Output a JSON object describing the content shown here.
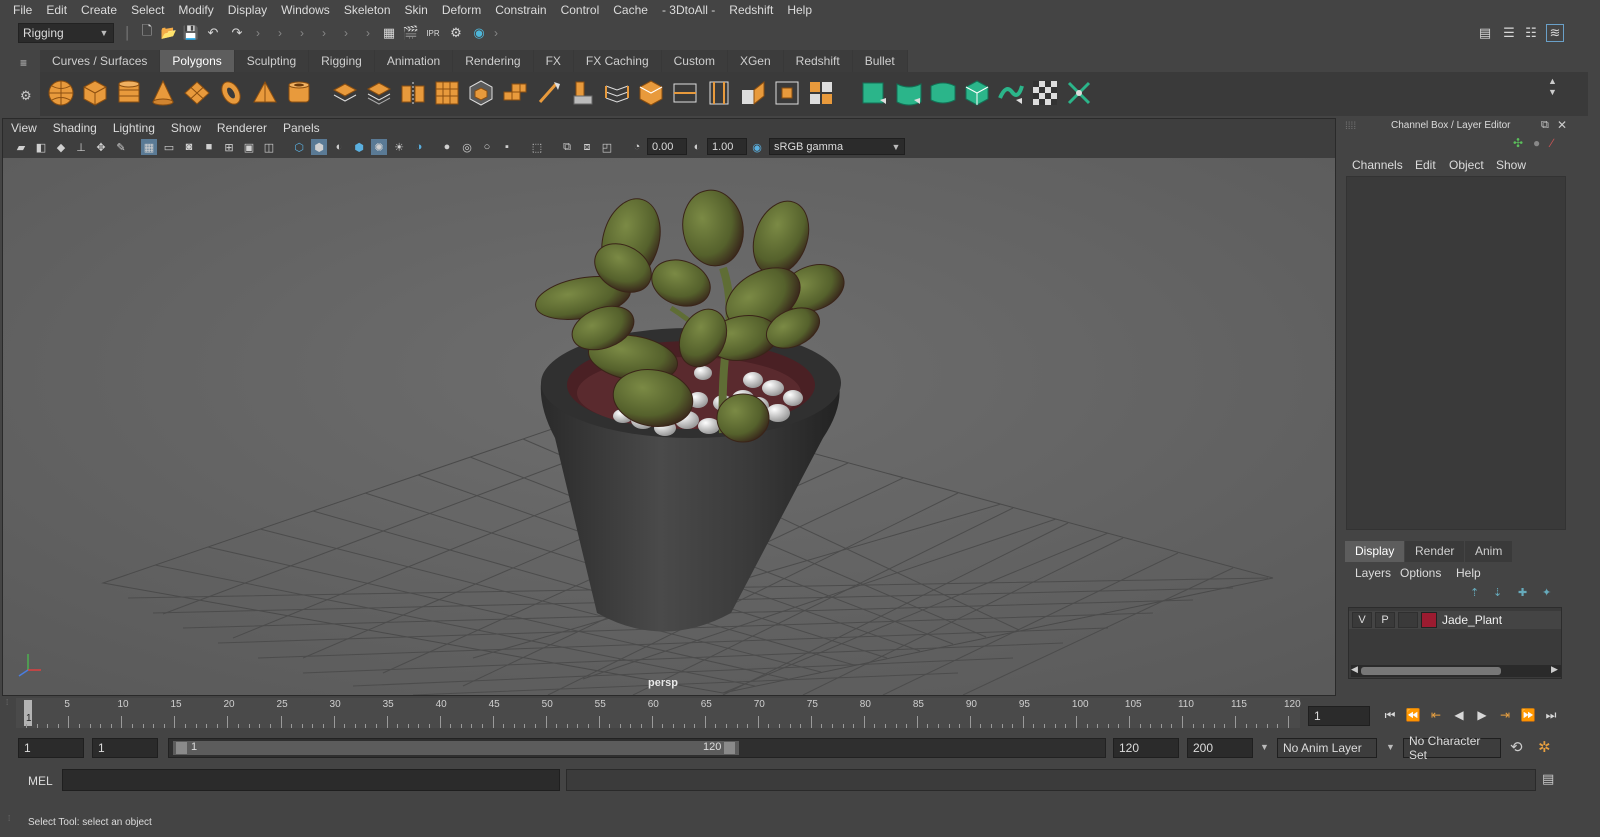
{
  "menubar": {
    "items": [
      "File",
      "Edit",
      "Create",
      "Select",
      "Modify",
      "Display",
      "Windows",
      "Skeleton",
      "Skin",
      "Deform",
      "Constrain",
      "Control",
      "Cache",
      "- 3DtoAll -",
      "Redshift",
      "Help"
    ]
  },
  "statusline": {
    "menuset": "Rigging"
  },
  "shelf": {
    "tabs": [
      "Curves / Surfaces",
      "Polygons",
      "Sculpting",
      "Rigging",
      "Animation",
      "Rendering",
      "FX",
      "FX Caching",
      "Custom",
      "XGen",
      "Redshift",
      "Bullet"
    ],
    "active_tab": "Polygons"
  },
  "panel": {
    "menus": [
      "View",
      "Shading",
      "Lighting",
      "Show",
      "Renderer",
      "Panels"
    ],
    "exposure": "0.00",
    "gamma": "1.00",
    "colorspace": "sRGB gamma",
    "camera_label": "persp"
  },
  "right_panel": {
    "title": "Channel Box / Layer Editor",
    "channel_menus": [
      "Channels",
      "Edit",
      "Object",
      "Show"
    ],
    "layer_tabs": [
      "Display",
      "Render",
      "Anim"
    ],
    "active_layer_tab": "Display",
    "layer_menus": [
      "Layers",
      "Options",
      "Help"
    ],
    "layers": [
      {
        "visible": "V",
        "playback": "P",
        "color": "#9b1b30",
        "name": "Jade_Plant"
      }
    ]
  },
  "timeline": {
    "ticks": [
      "5",
      "10",
      "15",
      "20",
      "25",
      "30",
      "35",
      "40",
      "45",
      "50",
      "55",
      "60",
      "65",
      "70",
      "75",
      "80",
      "85",
      "90",
      "95",
      "100",
      "105",
      "110",
      "115",
      "120"
    ],
    "current_marker": "1",
    "current_frame": "1"
  },
  "range": {
    "start": "1",
    "anim_start": "1",
    "slider_start": "1",
    "slider_end": "120",
    "end": "120",
    "anim_end": "200",
    "anim_layer": "No Anim Layer",
    "char_set": "No Character Set"
  },
  "cmdline": {
    "label": "MEL"
  },
  "helpline": {
    "text": "Select Tool: select an object"
  }
}
